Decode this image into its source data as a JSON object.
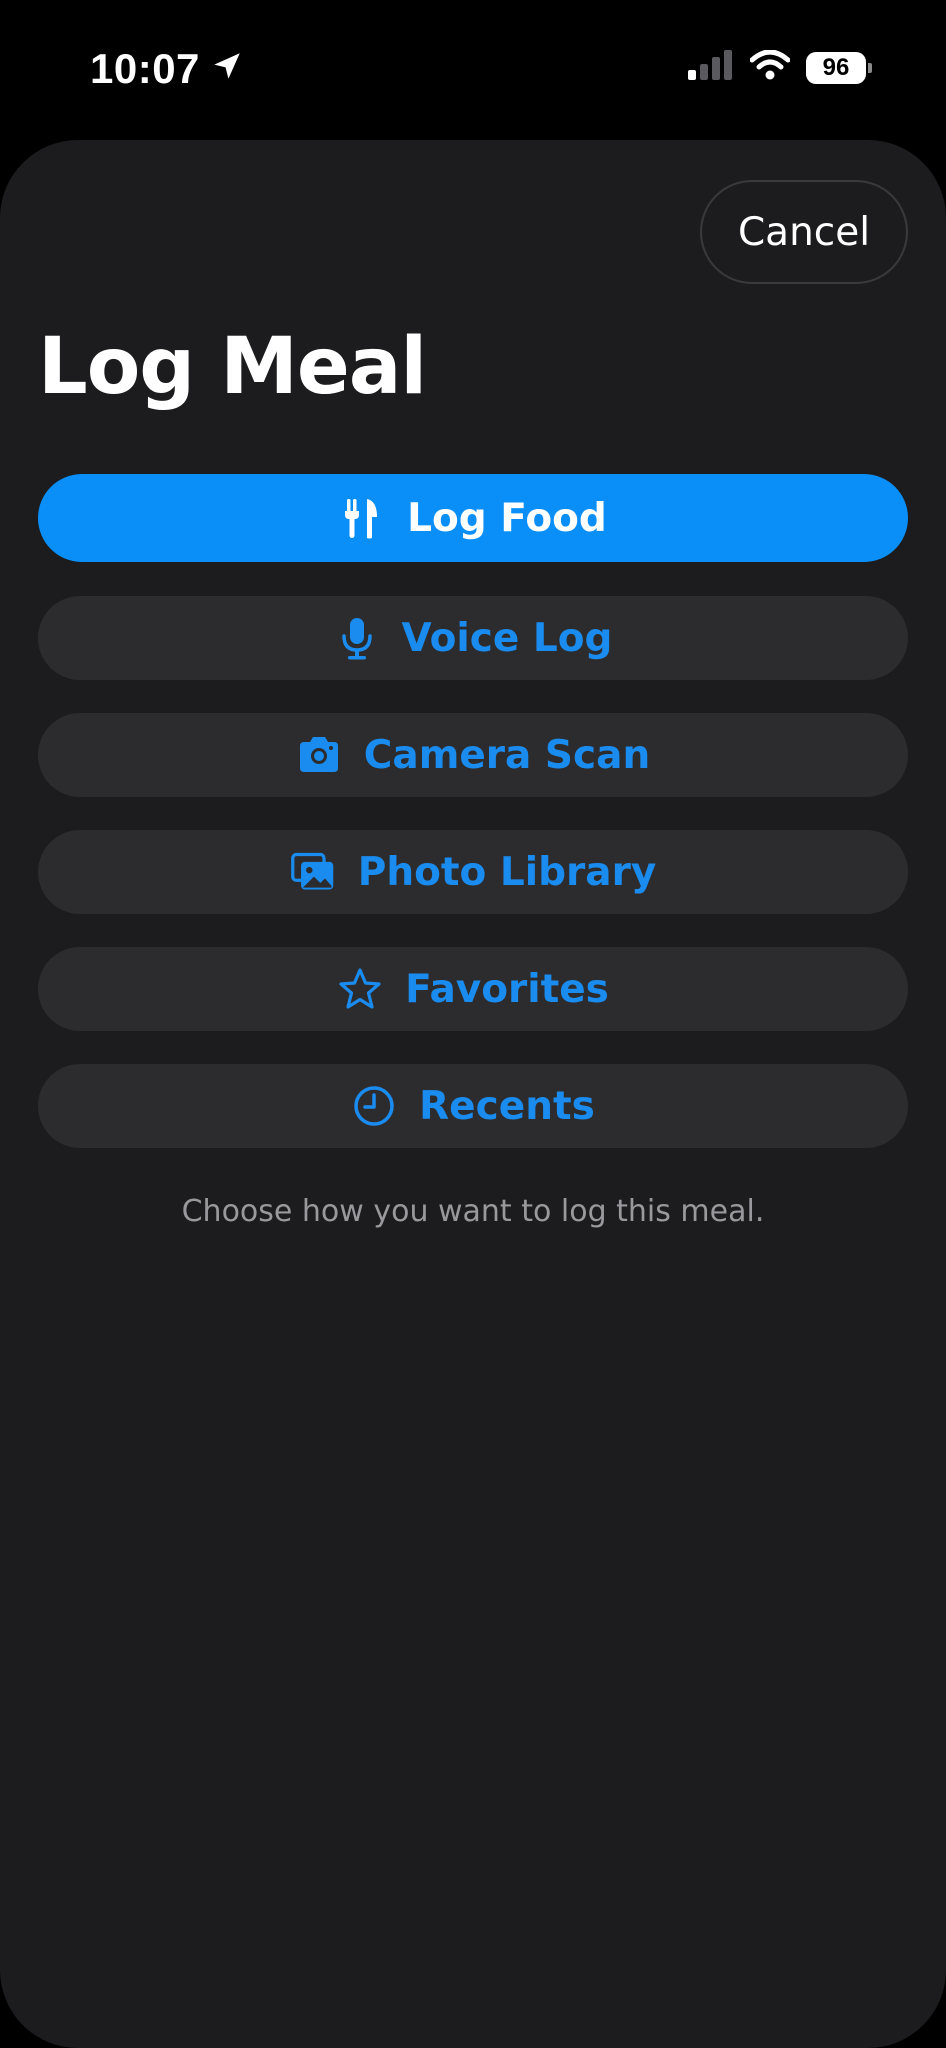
{
  "status_bar": {
    "time": "10:07",
    "battery": "96"
  },
  "header": {
    "cancel_label": "Cancel",
    "title": "Log Meal"
  },
  "options": [
    {
      "label": "Log Food",
      "icon": "fork-knife-icon"
    },
    {
      "label": "Voice Log",
      "icon": "microphone-icon"
    },
    {
      "label": "Camera Scan",
      "icon": "camera-icon"
    },
    {
      "label": "Photo Library",
      "icon": "photo-library-icon"
    },
    {
      "label": "Favorites",
      "icon": "star-icon"
    },
    {
      "label": "Recents",
      "icon": "clock-icon"
    }
  ],
  "hint": "Choose how you want to log this meal.",
  "colors": {
    "accent": "#0a8ff9",
    "option_text": "#1a8cf0",
    "sheet_bg": "#1c1c1e",
    "option_bg": "#2c2c2e"
  }
}
